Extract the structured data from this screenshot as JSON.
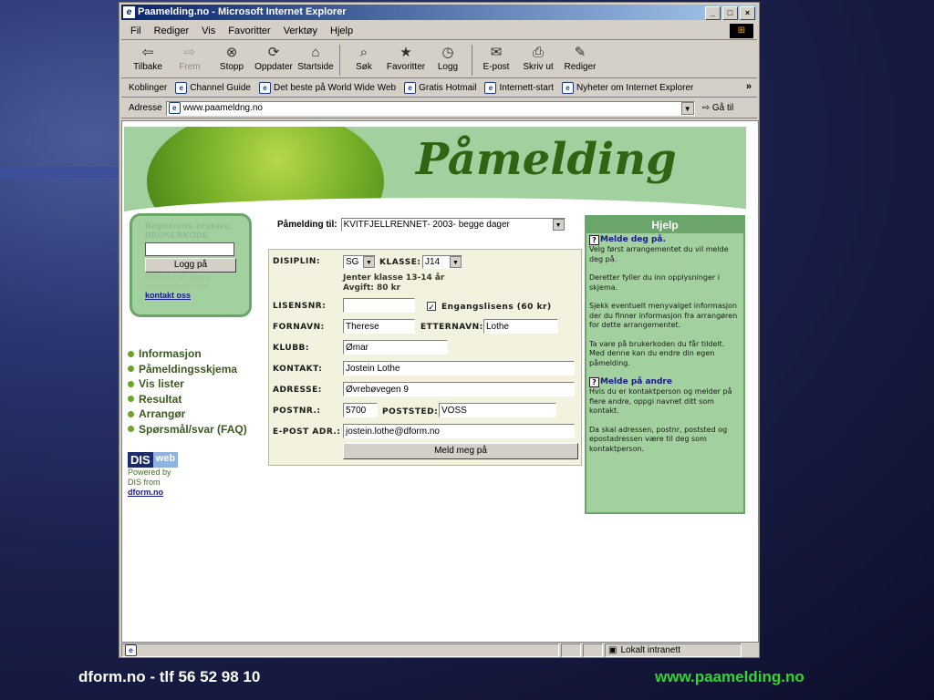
{
  "window": {
    "title": "Paamelding.no - Microsoft Internet Explorer",
    "title_icon": "ie-icon",
    "controls": [
      "_",
      "□",
      "×"
    ]
  },
  "menu": [
    "Fil",
    "Rediger",
    "Vis",
    "Favoritter",
    "Verktøy",
    "Hjelp"
  ],
  "menu_logo": "ms-windows-logo",
  "toolbar": [
    {
      "label": "Tilbake",
      "icon": "back-arrow-icon",
      "glyph": "⇦",
      "disabled": false
    },
    {
      "label": "Frem",
      "icon": "forward-arrow-icon",
      "glyph": "⇨",
      "disabled": true
    },
    {
      "label": "Stopp",
      "icon": "stop-icon",
      "glyph": "⊗",
      "disabled": false
    },
    {
      "label": "Oppdater",
      "icon": "refresh-icon",
      "glyph": "⟳",
      "disabled": false
    },
    {
      "label": "Startside",
      "icon": "home-icon",
      "glyph": "⌂",
      "disabled": false
    },
    {
      "label": "Søk",
      "icon": "search-icon",
      "glyph": "⌕",
      "disabled": false
    },
    {
      "label": "Favoritter",
      "icon": "favorites-icon",
      "glyph": "★",
      "disabled": false
    },
    {
      "label": "Logg",
      "icon": "history-icon",
      "glyph": "◷",
      "disabled": false
    },
    {
      "label": "E-post",
      "icon": "mail-icon",
      "glyph": "✉",
      "disabled": false
    },
    {
      "label": "Skriv ut",
      "icon": "print-icon",
      "glyph": "⎙",
      "disabled": false
    },
    {
      "label": "Rediger",
      "icon": "edit-icon",
      "glyph": "✎",
      "disabled": false
    }
  ],
  "links": {
    "label": "Koblinger",
    "items": [
      "Channel Guide",
      "Det beste på World Wide Web",
      "Gratis Hotmail",
      "Internett-start",
      "Nyheter om Internet Explorer"
    ],
    "more": "»"
  },
  "address": {
    "label": "Adresse",
    "url": "www.paameldng.no",
    "go_label": "Gå til"
  },
  "banner": {
    "title": "Påmelding"
  },
  "login": {
    "label1": "Registrerte brukere:",
    "label2": "BRUKERKODE",
    "button": "Logg på",
    "forgot": "Om du har glemt brukerkoden din",
    "contact_link": "kontakt oss"
  },
  "nav": [
    "Informasjon",
    "Påmeldingsskjema",
    "Vis lister",
    "Resultat",
    "Arrangør",
    "Spørsmål/svar (FAQ)"
  ],
  "dis": {
    "dis": "DIS",
    "web": "web",
    "powered": "Powered by",
    "from": "DIS from",
    "link": "dform.no"
  },
  "form": {
    "pamelding_label": "Påmelding til:",
    "event": "KVITFJELLRENNET- 2003- begge dager",
    "disiplin_label": "DISIPLIN:",
    "disiplin": "SG",
    "klasse_label": "KLASSE:",
    "klasse": "J14",
    "class_desc": "Jenter klasse 13-14 år",
    "fee": "Avgift: 80 kr",
    "lisens_label": "LISENSNR:",
    "lisens": "",
    "engangs_label": "Engangslisens (60 kr)",
    "engangs_checked": true,
    "fornavn_label": "FORNAVN:",
    "fornavn": "Therese",
    "etternavn_label": "ETTERNAVN:",
    "etternavn": "Lothe",
    "klubb_label": "KLUBB:",
    "klubb": "Ømar",
    "kontakt_label": "KONTAKT:",
    "kontakt": "Jostein Lothe",
    "adresse_label": "ADRESSE:",
    "adresse": "Øvrebøvegen 9",
    "postnr_label": "POSTNR.:",
    "postnr": "5700",
    "poststed_label": "POSTSTED:",
    "poststed": "VOSS",
    "epost_label": "E-POST ADR.:",
    "epost": "jostein.lothe@dform.no",
    "submit": "Meld meg på"
  },
  "help": {
    "title": "Hjelp",
    "sub1": "Melde deg på.",
    "p1": "Velg først arrangementet du vil melde deg på.",
    "p2": "Deretter fyller du inn opplysninger i skjema.",
    "p3": "Sjekk eventuelt menyvalget informasjon der du finner informasjon fra arrangøren for dette arrangementet.",
    "p4": "Ta vare på brukerkoden du får tildelt. Med denne kan du endre din egen påmelding.",
    "sub2": "Melde på andre",
    "p5": "Hvis du er kontaktperson og melder på flere andre, oppgi navnet ditt som kontakt.",
    "p6": "Da skal adressen, postnr, poststed og epostadressen være til deg som kontaktperson."
  },
  "status": {
    "zone": "Lokalt intranett"
  },
  "footer": {
    "left": "dform.no - tlf  56 52 98 10",
    "right": "www.paamelding.no"
  }
}
